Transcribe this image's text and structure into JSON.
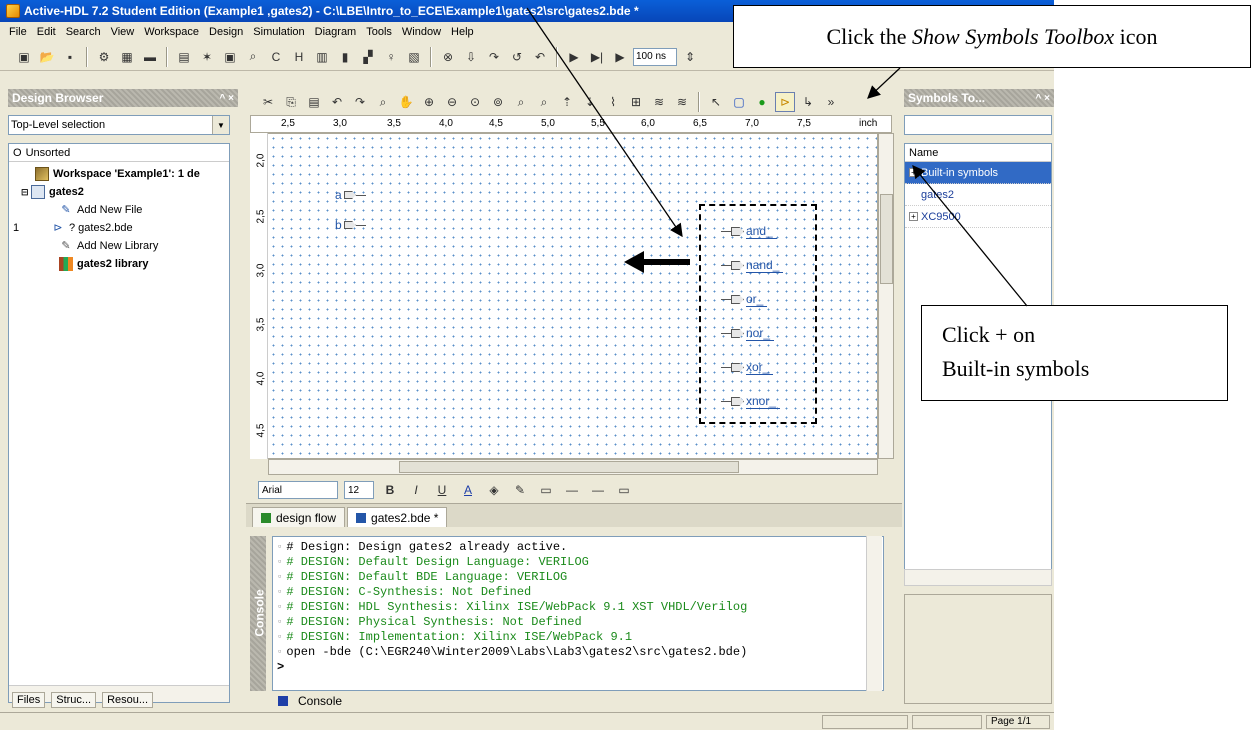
{
  "window": {
    "title": "Active-HDL 7.2 Student Edition (Example1 ,gates2) - C:\\LBE\\Intro_to_ECE\\Example1\\gates2\\src\\gates2.bde *"
  },
  "menu": [
    "File",
    "Edit",
    "Search",
    "View",
    "Workspace",
    "Design",
    "Simulation",
    "Diagram",
    "Tools",
    "Window",
    "Help"
  ],
  "toolbar": {
    "sim_time": "100 ns"
  },
  "design_browser": {
    "title": "Design Browser",
    "selection": "Top-Level selection",
    "column": "Unsorted",
    "items": [
      {
        "label": "Workspace 'Example1': 1 de",
        "bold": true
      },
      {
        "label": "gates2",
        "bold": true
      },
      {
        "label": "Add New File"
      },
      {
        "label": "? gates2.bde",
        "prefix": "1"
      },
      {
        "label": "Add New Library"
      },
      {
        "label": "gates2 library",
        "bold": true
      }
    ],
    "tabs": [
      "Files",
      "Struc...",
      "Resou..."
    ]
  },
  "ruler": {
    "units": "inch",
    "h_ticks": [
      "2,5",
      "3,0",
      "3,5",
      "4,0",
      "4,5",
      "5,0",
      "5,5",
      "6,0",
      "6,5",
      "7,0",
      "7,5"
    ],
    "v_ticks": [
      "2,0",
      "2,5",
      "3,0",
      "3,5",
      "4,0",
      "4,5"
    ]
  },
  "schematic": {
    "inputs": [
      "a",
      "b"
    ],
    "symbols": [
      "and_",
      "nand_",
      "or_",
      "nor_",
      "xor_",
      "xnor_"
    ]
  },
  "format_toolbar": {
    "font": "Arial",
    "size": "12"
  },
  "document_tabs": [
    "design flow",
    "gates2.bde *"
  ],
  "console": {
    "label": "Console",
    "lines": [
      {
        "text": "# Design: Design gates2 already active.",
        "color": "#000000"
      },
      {
        "text": "# DESIGN: Default Design Language: VERILOG",
        "color": "#1a8a1a"
      },
      {
        "text": "# DESIGN: Default BDE Language: VERILOG",
        "color": "#1a8a1a"
      },
      {
        "text": "# DESIGN: C-Synthesis: Not Defined",
        "color": "#1a8a1a"
      },
      {
        "text": "# DESIGN: HDL Synthesis: Xilinx ISE/WebPack 9.1 XST VHDL/Verilog",
        "color": "#1a8a1a"
      },
      {
        "text": "# DESIGN: Physical Synthesis: Not Defined",
        "color": "#1a8a1a"
      },
      {
        "text": "# DESIGN: Implementation: Xilinx ISE/WebPack 9.1",
        "color": "#1a8a1a"
      },
      {
        "text": "open -bde (C:\\EGR240\\Winter2009\\Labs\\Lab3\\gates2\\src\\gates2.bde)",
        "color": "#000000"
      }
    ],
    "prompt": ">",
    "tab": "Console"
  },
  "symbols_toolbox": {
    "title": "Symbols To...",
    "column": "Name",
    "items": [
      "Built-in symbols",
      "gates2",
      "XC9500"
    ]
  },
  "status": {
    "page": "Page 1/1"
  },
  "callouts": {
    "show_symbols": {
      "prefix": "Click the ",
      "emph": "Show Symbols Toolbox",
      "suffix": " icon"
    },
    "builtin_line1": "Click + on",
    "builtin_line2": "Built-in symbols"
  },
  "colors": {
    "title_bar": "#0a5fd8",
    "selection": "#316ac5",
    "console_green": "#1a8a1a"
  }
}
